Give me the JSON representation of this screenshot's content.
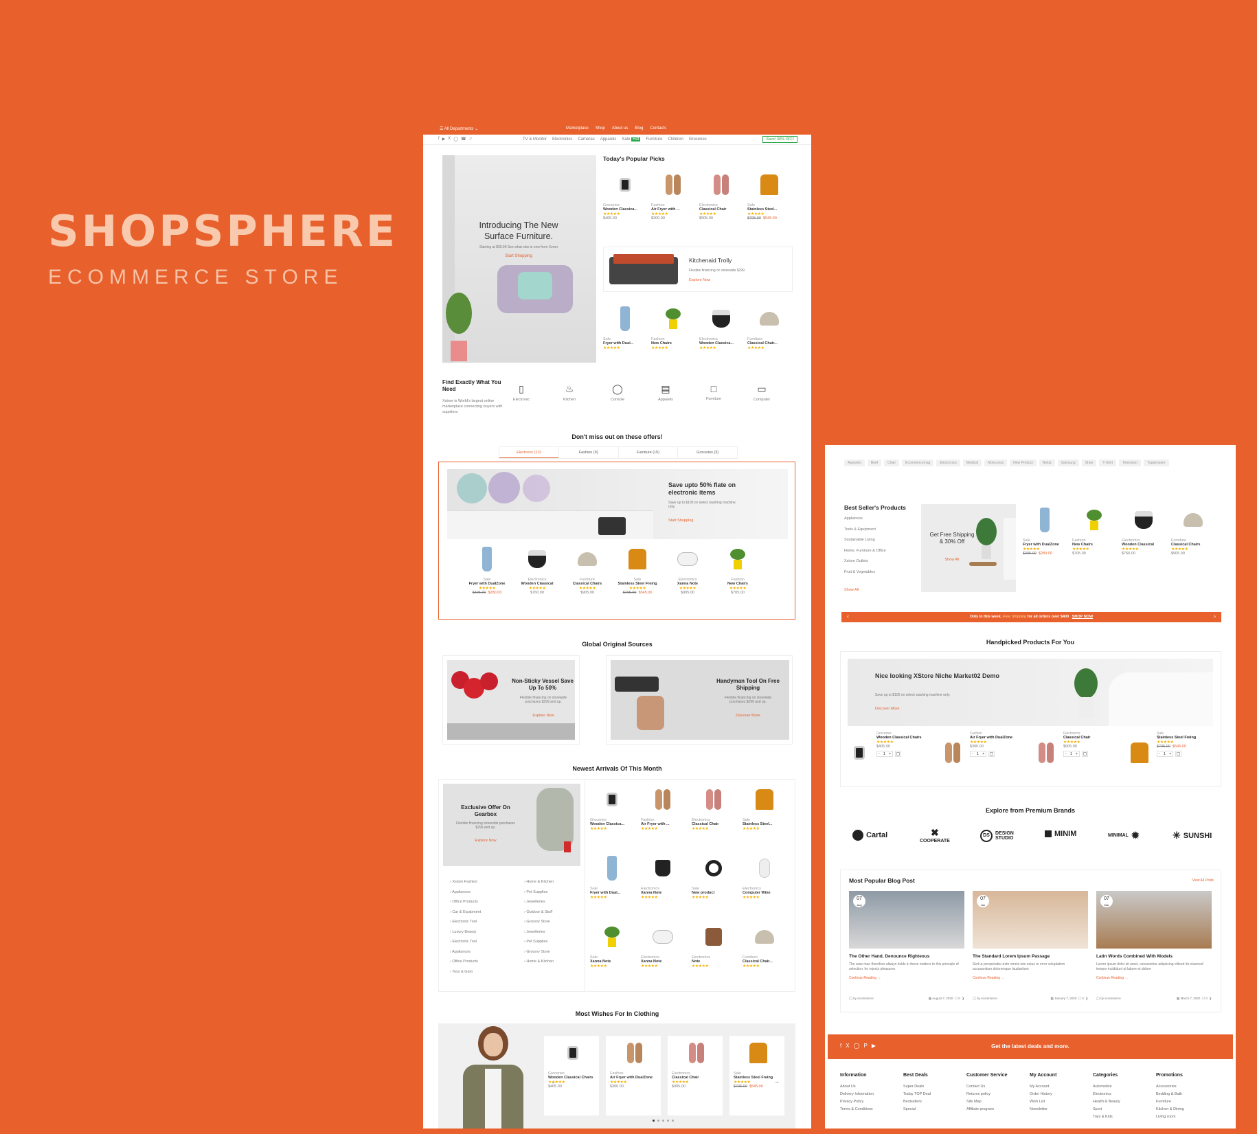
{
  "brand": {
    "name": "SHOPSPHERE",
    "subtitle": "ECOMMERCE STORE"
  },
  "header": {
    "departments": "All Departments",
    "nav": [
      "Marketplace",
      "Shop",
      "About us",
      "Blog",
      "Contacts"
    ],
    "categories": [
      "TV & Monitor",
      "Electronics",
      "Cameras",
      "Apparels",
      "Sale",
      "Furniture",
      "Children",
      "Groceries"
    ],
    "sale_badge": "Hot",
    "promo": "Save! 30% OFF!"
  },
  "hero": {
    "title": "Introducing The New Surface Furniture.",
    "subtitle": "Starting at $99.99 See what else is new from Xeron",
    "cta": "Start Shopping"
  },
  "popular": {
    "title": "Today's Popular Picks",
    "row1": [
      {
        "cat": "Groceries",
        "name": "Wooden Classica...",
        "price": "$405.00",
        "old": ""
      },
      {
        "cat": "Fashion",
        "name": "Air Fryer with ...",
        "price": "$300.00",
        "old": ""
      },
      {
        "cat": "Electronics",
        "name": "Classical Chair",
        "price": "$905.00",
        "old": ""
      },
      {
        "cat": "Sale",
        "name": "Stainless Steel...",
        "price": "$545.00",
        "old": "$705.00"
      }
    ],
    "banner": {
      "title": "Kitchenaid Trolly",
      "text": "Flexible financing on storewide $299.",
      "cta": "Explore Now"
    },
    "row2": [
      {
        "cat": "Sale",
        "name": "Fryer with Dual..."
      },
      {
        "cat": "Fashion",
        "name": "New Chairs"
      },
      {
        "cat": "Electronics",
        "name": "Wooden Classica..."
      },
      {
        "cat": "Furniture",
        "name": "Classical Chair..."
      }
    ]
  },
  "find": {
    "title": "Find Exactly What You Need",
    "text": "Xstore is World's largest online marketplace connecting buyers with suppliers.",
    "items": [
      "Electronic",
      "Kitchen",
      "Console",
      "Apparels",
      "Furniture",
      "Computer"
    ]
  },
  "offers": {
    "title": "Don't miss out on these offers!",
    "tabs": [
      "Electronic (12)",
      "Fashion (9)",
      "Furniture (15)",
      "Groceries (3)"
    ],
    "banner": {
      "title": "Save upto 50% flate on electronic items",
      "text": "Save up to $100 on select washing machine only.",
      "cta": "Start Shopping"
    },
    "products": [
      {
        "cat": "Sale",
        "name": "Fryer with DualZone",
        "price": "$280.00",
        "old": "$305.00"
      },
      {
        "cat": "Electronics",
        "name": "Wooden Classical",
        "price": "$760.00",
        "old": ""
      },
      {
        "cat": "Furniture",
        "name": "Classical Chairs",
        "price": "$905.00",
        "old": ""
      },
      {
        "cat": "Sale",
        "name": "Stainless Steel Freing",
        "price": "$545.00",
        "old": "$705.00"
      },
      {
        "cat": "Electronics",
        "name": "Xanna Note",
        "price": "$905.00",
        "old": ""
      },
      {
        "cat": "Fashion",
        "name": "New Chairs",
        "price": "$705.00",
        "old": ""
      }
    ]
  },
  "sources": {
    "title": "Global Original Sources",
    "cards": [
      {
        "title": "Non-Sticky Vessel Save Up To 50%",
        "text": "Flexible financing on storewide purchases $299 and up.",
        "cta": "Explore Now"
      },
      {
        "title": "Handyman Tool On Free Shipping",
        "text": "Flexible financing on storewide purchases $299 and up.",
        "cta": "Discover More"
      }
    ]
  },
  "arrivals": {
    "title": "Newest Arrivals Of This Month",
    "banner": {
      "title": "Exclusive Offer On Gearbox",
      "text": "Flexible financing storewide purchases $299 and up.",
      "cta": "Explore Now"
    },
    "links_left": [
      "Xstore Fashion",
      "Appliances",
      "Office Products",
      "Car & Equipment",
      "Electronic Tool",
      "Luxury Beauty",
      "Electronic Tool",
      "Appliances",
      "Office Products",
      "Toys & Gam"
    ],
    "links_right": [
      "Home & Kitchen",
      "Pet Supplies",
      "Jewelleries",
      "Outdoor & Stuff",
      "Grocery Store",
      "Jewelleries",
      "Pet Supplies",
      "Grocery Store",
      "Home & Kitchen"
    ],
    "grid": [
      {
        "cat": "Groceries",
        "name": "Wooden Classica..."
      },
      {
        "cat": "Fashion",
        "name": "Air Fryer with ..."
      },
      {
        "cat": "Electronics",
        "name": "Classical Chair"
      },
      {
        "cat": "Sale",
        "name": "Stainless Steel..."
      },
      {
        "cat": "Sale",
        "name": "Fryer with Dual..."
      },
      {
        "cat": "Electronics",
        "name": "Xanna Note"
      },
      {
        "cat": "Sale",
        "name": "New product"
      },
      {
        "cat": "Electronics",
        "name": "Computer Wine"
      },
      {
        "cat": "Sale",
        "name": "Xanna Note"
      },
      {
        "cat": "Electronics",
        "name": "Xanna Note"
      },
      {
        "cat": "Electronics",
        "name": "Note"
      },
      {
        "cat": "Furniture",
        "name": "Classical Chair..."
      }
    ]
  },
  "wishes": {
    "title": "Most Wishes For In Clothing",
    "products": [
      {
        "cat": "Groceries",
        "name": "Wooden Classical Chairs",
        "price": "$405.00",
        "old": ""
      },
      {
        "cat": "Fashion",
        "name": "Air Fryer with DualZone",
        "price": "$300.00",
        "old": ""
      },
      {
        "cat": "Electronics",
        "name": "Classical Chair",
        "price": "$905.00",
        "old": ""
      },
      {
        "cat": "Sale",
        "name": "Stainless Steel Freing",
        "price": "$545.00",
        "old": "$705.00"
      }
    ]
  },
  "tags": [
    "Apparels",
    "Beef",
    "Chair",
    "Ecommercemag",
    "Electronics",
    "Medical",
    "Motocross",
    "New Product",
    "Nokia",
    "Samsung",
    "Shoe",
    "T-Shirt",
    "Television",
    "Tupperware"
  ],
  "bestsellers": {
    "title": "Best Seller's Products",
    "links": [
      "Appliances",
      "Tools & Equipment",
      "Sustainable Living",
      "Home, Furniture & Office",
      "Xstore Outlets",
      "Fruit & Vegetables"
    ],
    "show_all": "Show All",
    "banner": {
      "title": "Get Free Shipping & 30% Off",
      "cta": "Show All"
    },
    "products": [
      {
        "cat": "Sale",
        "name": "Fryer with DualZone",
        "price": "$280.00",
        "old": "$305.00"
      },
      {
        "cat": "Fashion",
        "name": "New Chairs",
        "price": "$705.00",
        "old": ""
      },
      {
        "cat": "Electronics",
        "name": "Wooden Classical",
        "price": "$760.00",
        "old": ""
      },
      {
        "cat": "Furniture",
        "name": "Classical Chairs",
        "price": "$905.00",
        "old": ""
      }
    ]
  },
  "promo_strip": {
    "text1": "Only in this week.",
    "text2": "Free Shipping",
    "text3": "for all orders over $400",
    "cta": "SHOP NOW"
  },
  "handpicked": {
    "title": "Handpicked Products For You",
    "banner": {
      "title": "Nice looking XStore Niche Market02 Demo",
      "text": "Save up to $100 on select washing machine only.",
      "cta": "Discover More"
    },
    "products": [
      {
        "cat": "Groceries",
        "name": "Wooden Classical Chairs",
        "price": "$405.00",
        "old": "",
        "qty": "1"
      },
      {
        "cat": "Fashion",
        "name": "Air Fryer with DualZone",
        "price": "$300.00",
        "old": "",
        "qty": "1"
      },
      {
        "cat": "Electronics",
        "name": "Classical Chair",
        "price": "$905.00",
        "old": "",
        "qty": "1"
      },
      {
        "cat": "Sale",
        "name": "Stainless Steel Freing",
        "price": "$545.00",
        "old": "$705.00",
        "qty": "1"
      }
    ]
  },
  "brands": {
    "title": "Explore from Premium Brands",
    "items": [
      "Cartal",
      "COOPERATE",
      "DESIGN STUDIO",
      "MINIM",
      "MINIMAL",
      "SUNSHI"
    ]
  },
  "blog": {
    "title": "Most Popular Blog Post",
    "view_all": "View All Posts",
    "posts": [
      {
        "day": "07",
        "month": "Aug",
        "title": "The Other Hand, Denounce Righteous",
        "text": "The wise man therefore always holds in these matters to this principle of selection: he rejects pleasures",
        "more": "Continue Reading",
        "author": "by ecommerce",
        "date": "August 7, 2020",
        "comments": "0"
      },
      {
        "day": "07",
        "month": "Jan",
        "title": "The Standard Lorem Ipsum Passage",
        "text": "Sed ut perspiciatis unde omnis iste natus to error voluptatem accusantium doloremque laudantium",
        "more": "Continue Reading",
        "author": "by ecommerce",
        "date": "January 7, 2020",
        "comments": "0"
      },
      {
        "day": "07",
        "month": "Mar",
        "title": "Latin Words Combined With Models",
        "text": "Lorem ipsum dolor sit amet, consectetur adipiscing elitsed do eiusmod tempor incididunt ut labore et dolore",
        "more": "Continue Reading",
        "author": "by ecommerce",
        "date": "March 7, 2020",
        "comments": "0"
      }
    ]
  },
  "newsletter": {
    "text": "Get the latest deals and more."
  },
  "footer": [
    {
      "title": "Information",
      "links": [
        "About Us",
        "Delivery Information",
        "Privacy Policy",
        "Terms & Conditions"
      ]
    },
    {
      "title": "Best Deals",
      "links": [
        "Super Deals",
        "Today TOP Deal",
        "Bestsellers",
        "Special"
      ]
    },
    {
      "title": "Customer Service",
      "links": [
        "Contact Us",
        "Returns policy",
        "Site Map",
        "Affiliate program"
      ]
    },
    {
      "title": "My Account",
      "links": [
        "My Account",
        "Order History",
        "Wish List",
        "Newsletter"
      ]
    },
    {
      "title": "Categories",
      "links": [
        "Automotive",
        "Electronics",
        "Health & Beauty",
        "Sport",
        "Toys & Kids"
      ]
    },
    {
      "title": "Promotions",
      "links": [
        "Accessories",
        "Bedding & Bath",
        "Furniture",
        "Kitchen & Dining",
        "Living room"
      ]
    }
  ],
  "colors": {
    "accent": "#e8602c",
    "star": "#f5b000",
    "background": "#e8602c"
  }
}
